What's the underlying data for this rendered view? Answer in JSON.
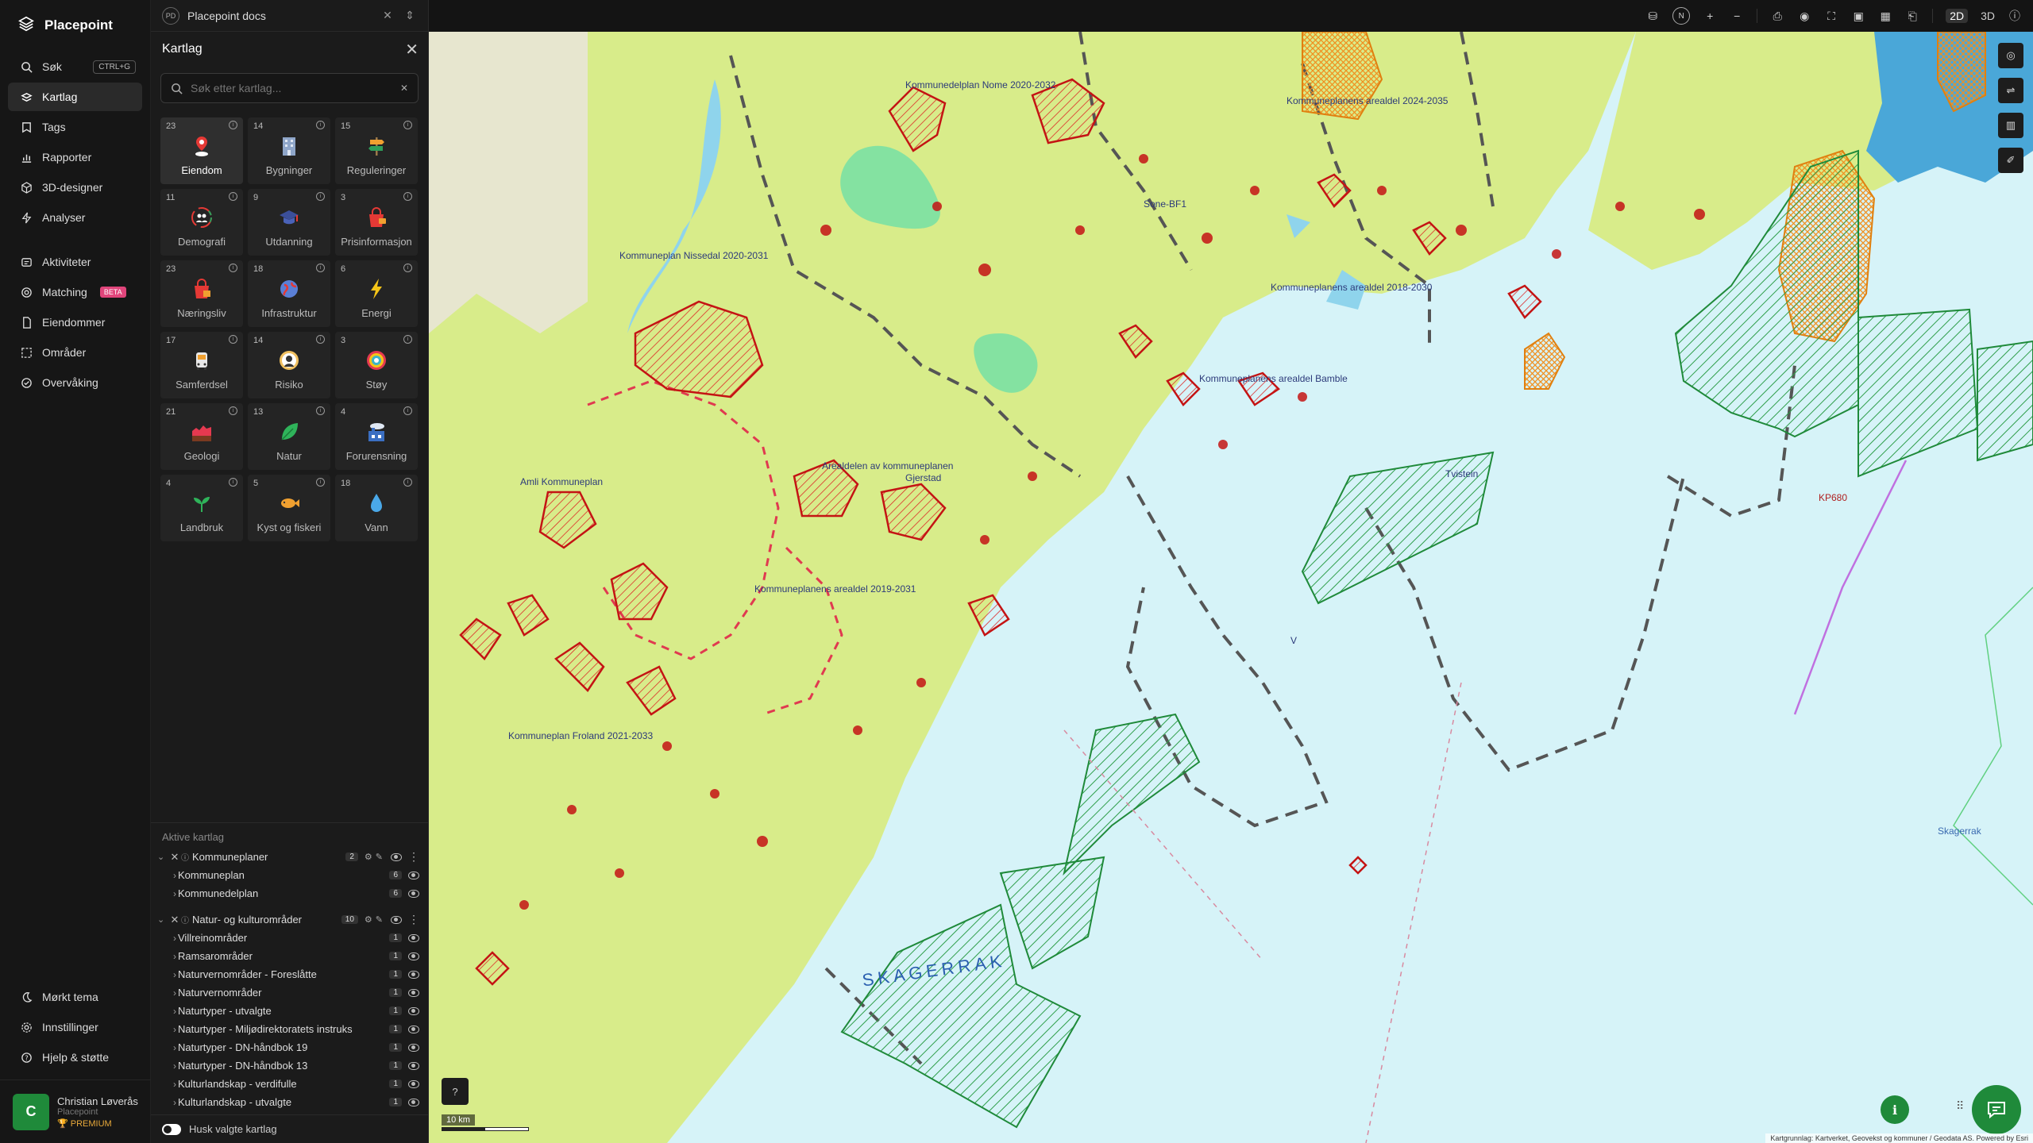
{
  "app": {
    "name": "Placepoint"
  },
  "nav": {
    "items": [
      {
        "label": "Søk",
        "shortcut": "CTRL+G",
        "icon": "search-icon"
      },
      {
        "label": "Kartlag",
        "icon": "layers-icon",
        "active": true
      },
      {
        "label": "Tags",
        "icon": "tag-icon"
      },
      {
        "label": "Rapporter",
        "icon": "chart-icon"
      },
      {
        "label": "3D-designer",
        "icon": "cube-icon"
      },
      {
        "label": "Analyser",
        "icon": "analyze-icon"
      }
    ],
    "items2": [
      {
        "label": "Aktiviteter",
        "icon": "activity-icon"
      },
      {
        "label": "Matching",
        "badge": "BETA",
        "icon": "match-icon"
      },
      {
        "label": "Eiendommer",
        "icon": "doc-icon"
      },
      {
        "label": "Områder",
        "icon": "area-icon"
      },
      {
        "label": "Overvåking",
        "icon": "monitor-icon"
      }
    ],
    "bottom": [
      {
        "label": "Mørkt tema",
        "icon": "moon-icon"
      },
      {
        "label": "Innstillinger",
        "icon": "gear-icon"
      },
      {
        "label": "Hjelp & støtte",
        "icon": "help-icon"
      }
    ],
    "user": {
      "initial": "C",
      "name": "Christian Løverås",
      "org": "Placepoint",
      "plan": "PREMIUM"
    }
  },
  "panel": {
    "workspace_badge": "PD",
    "workspace": "Placepoint docs",
    "title": "Kartlag",
    "search_placeholder": "Søk etter kartlag...",
    "categories": [
      {
        "count": "23",
        "label": "Eiendom",
        "icon": "pin-icon",
        "active": true
      },
      {
        "count": "14",
        "label": "Bygninger",
        "icon": "building-icon"
      },
      {
        "count": "15",
        "label": "Reguleringer",
        "icon": "signpost-icon"
      },
      {
        "count": "11",
        "label": "Demografi",
        "icon": "people-icon"
      },
      {
        "count": "9",
        "label": "Utdanning",
        "icon": "graduation-icon"
      },
      {
        "count": "3",
        "label": "Prisinformasjon",
        "icon": "price-icon"
      },
      {
        "count": "23",
        "label": "Næringsliv",
        "icon": "shop-icon"
      },
      {
        "count": "18",
        "label": "Infrastruktur",
        "icon": "globe-icon"
      },
      {
        "count": "6",
        "label": "Energi",
        "icon": "lightning-icon"
      },
      {
        "count": "17",
        "label": "Samferdsel",
        "icon": "bus-icon"
      },
      {
        "count": "14",
        "label": "Risiko",
        "icon": "risk-icon"
      },
      {
        "count": "3",
        "label": "Støy",
        "icon": "noise-icon"
      },
      {
        "count": "21",
        "label": "Geologi",
        "icon": "geology-icon"
      },
      {
        "count": "13",
        "label": "Natur",
        "icon": "leaf-icon"
      },
      {
        "count": "4",
        "label": "Forurensning",
        "icon": "factory-icon"
      },
      {
        "count": "4",
        "label": "Landbruk",
        "icon": "sprout-icon"
      },
      {
        "count": "5",
        "label": "Kyst og fiskeri",
        "icon": "fish-icon"
      },
      {
        "count": "18",
        "label": "Vann",
        "icon": "water-drop-icon"
      }
    ],
    "active_title": "Aktive kartlag",
    "groups": [
      {
        "name": "Kommuneplaner",
        "count": "2",
        "rows": [
          {
            "name": "Kommuneplan",
            "count": "6"
          },
          {
            "name": "Kommunedelplan",
            "count": "6"
          }
        ]
      },
      {
        "name": "Natur- og kulturområder",
        "count": "10",
        "rows": [
          {
            "name": "Villreinområder",
            "count": "1"
          },
          {
            "name": "Ramsarområder",
            "count": "1"
          },
          {
            "name": "Naturvernområder - Foreslåtte",
            "count": "1"
          },
          {
            "name": "Naturvernområder",
            "count": "1"
          },
          {
            "name": "Naturtyper - utvalgte",
            "count": "1"
          },
          {
            "name": "Naturtyper - Miljødirektoratets instruks",
            "count": "1"
          },
          {
            "name": "Naturtyper - DN-håndbok 19",
            "count": "1"
          },
          {
            "name": "Naturtyper - DN-håndbok 13",
            "count": "1"
          },
          {
            "name": "Kulturlandskap - verdifulle",
            "count": "1"
          },
          {
            "name": "Kulturlandskap - utvalgte",
            "count": "1"
          }
        ]
      }
    ],
    "remember_label": "Husk valgte kartlag"
  },
  "toolbar": {
    "mode_2d": "2D",
    "mode_3d": "3D",
    "compass": "N",
    "zoom_in": "+",
    "zoom_out": "−"
  },
  "map": {
    "scale": "10 km",
    "attribution": "Kartgrunnlag: Kartverket, Geovekst og kommuner / Geodata AS. Powered by Esri",
    "labels": [
      "Kommuneplanens arealdel Bamble",
      "Arealdelen av kommuneplanen",
      "Kommuneplanens arealdel 2019-2031",
      "Kommuneplan Froland 2021-2033",
      "SKAGERRAK",
      "Skagerrak",
      "Kommuneplan Nissedal 2020-2031",
      "Kommunedelplan Nome 2020-2032",
      "Kommuneplanens arealdel 2024-2035",
      "Kommuneplanens arealdel 2018-2030",
      "Sone-BF1",
      "Amli Kommuneplan",
      "Tvistein",
      "Gjerstad",
      "V",
      "KP680"
    ]
  }
}
